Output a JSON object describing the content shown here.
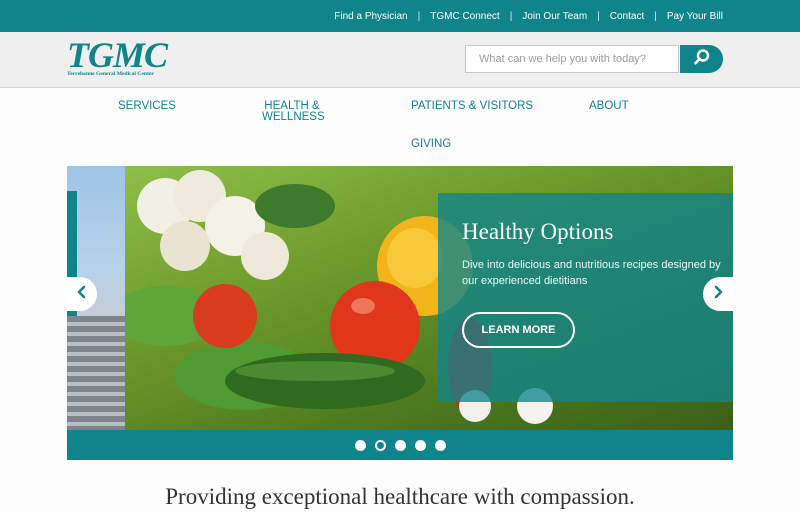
{
  "top_links": [
    "Find a Physician",
    "TGMC Connect",
    "Join Our Team",
    "Contact",
    "Pay Your Bill"
  ],
  "logo": {
    "mark": "TGMC",
    "subtitle": "Terrebonne General Medical Center"
  },
  "search": {
    "placeholder": "What can we help you with today?",
    "value": ""
  },
  "nav": {
    "services": "SERVICES",
    "health": "HEALTH & WELLNESS",
    "patients": "PATIENTS & VISITORS",
    "about": "ABOUT",
    "giving": "GIVING"
  },
  "hero": {
    "title": "Healthy Options",
    "text": "Dive into delicious and nutritious recipes designed by our experienced dietitians",
    "button": "LEARN MORE"
  },
  "slider": {
    "slide_count": 5,
    "active_slide": 2
  },
  "tagline": "Providing exceptional healthcare with compassion.",
  "colors": {
    "brand_teal": "#0f848a",
    "header_gray": "#efefef"
  },
  "icons": {
    "search": "search-icon",
    "prev": "chevron-left-icon",
    "next": "chevron-right-icon"
  }
}
